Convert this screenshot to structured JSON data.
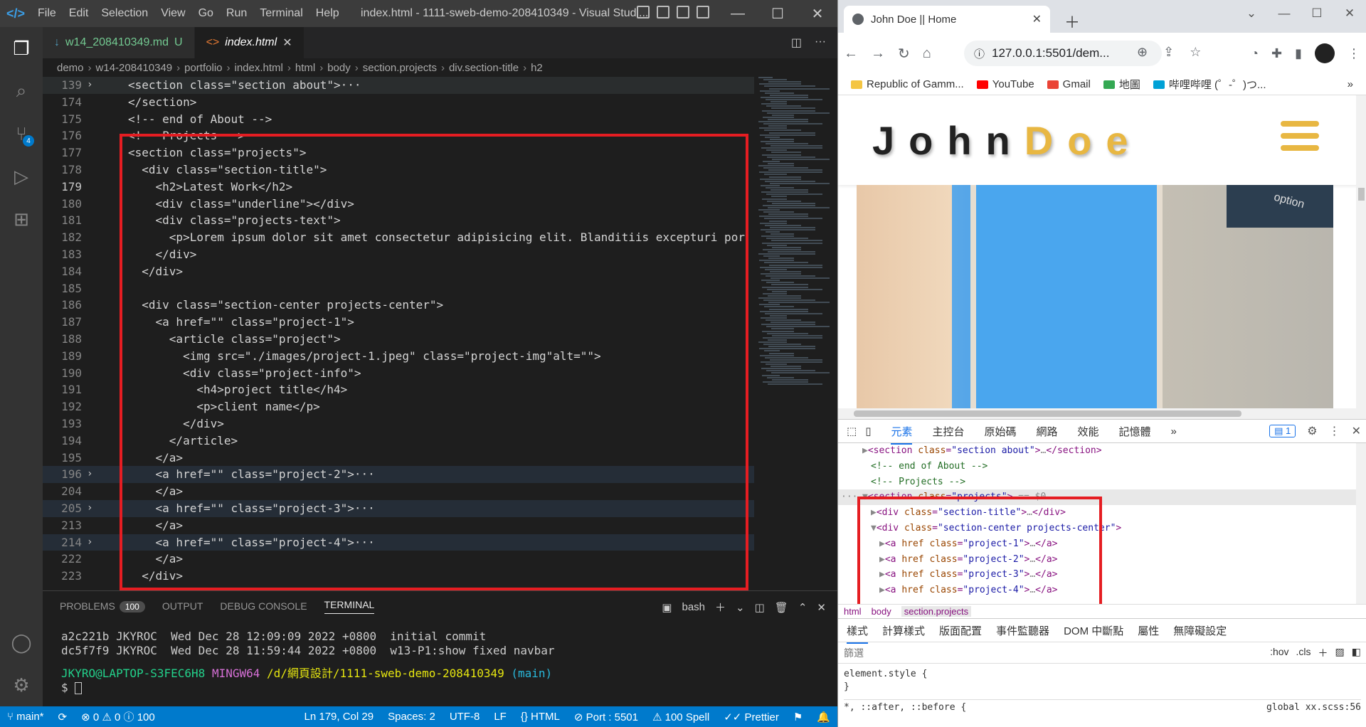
{
  "vscode": {
    "menu": [
      "File",
      "Edit",
      "Selection",
      "View",
      "Go",
      "Run",
      "Terminal",
      "Help"
    ],
    "window_title": "index.html - 1111-sweb-demo-208410349 - Visual Studi...",
    "tabs": [
      {
        "label": "w14_208410349.md",
        "status": "U"
      },
      {
        "label": "index.html"
      }
    ],
    "breadcrumbs": [
      "demo",
      "w14-208410349",
      "portfolio",
      "index.html",
      "html",
      "body",
      "section.projects",
      "div.section-title",
      "h2"
    ],
    "code_lines": [
      {
        "n": "139",
        "text": "<section class=\"section about\">···",
        "fold": "›",
        "cls": "hl"
      },
      {
        "n": "174",
        "text": "</section>"
      },
      {
        "n": "175",
        "text": "<!-- end of About -->"
      },
      {
        "n": "176",
        "text": "<!-- Projects -->"
      },
      {
        "n": "177",
        "text": "<section class=\"projects\">"
      },
      {
        "n": "178",
        "text": "  <div class=\"section-title\">"
      },
      {
        "n": "179",
        "text": "    <h2>Latest Work</h2>",
        "cur": true
      },
      {
        "n": "180",
        "text": "    <div class=\"underline\"></div>"
      },
      {
        "n": "181",
        "text": "    <div class=\"projects-text\">"
      },
      {
        "n": "182",
        "text": "      <p>Lorem ipsum dolor sit amet consectetur adipisicing elit. Blanditiis excepturi por"
      },
      {
        "n": "183",
        "text": "    </div>"
      },
      {
        "n": "184",
        "text": "  </div>"
      },
      {
        "n": "185",
        "text": ""
      },
      {
        "n": "186",
        "text": "  <div class=\"section-center projects-center\">"
      },
      {
        "n": "187",
        "text": "    <a href=\"\" class=\"project-1\">"
      },
      {
        "n": "188",
        "text": "      <article class=\"project\">"
      },
      {
        "n": "189",
        "text": "        <img src=\"./images/project-1.jpeg\" class=\"project-img\"alt=\"\">"
      },
      {
        "n": "190",
        "text": "        <div class=\"project-info\">"
      },
      {
        "n": "191",
        "text": "          <h4>project title</h4>"
      },
      {
        "n": "192",
        "text": "          <p>client name</p>"
      },
      {
        "n": "193",
        "text": "        </div>"
      },
      {
        "n": "194",
        "text": "      </article>"
      },
      {
        "n": "195",
        "text": "    </a>"
      },
      {
        "n": "196",
        "text": "    <a href=\"\" class=\"project-2\">···",
        "fold": "›",
        "cls": "folded"
      },
      {
        "n": "204",
        "text": "    </a>"
      },
      {
        "n": "205",
        "text": "    <a href=\"\" class=\"project-3\">···",
        "fold": "›",
        "cls": "folded"
      },
      {
        "n": "213",
        "text": "    </a>"
      },
      {
        "n": "214",
        "text": "    <a href=\"\" class=\"project-4\">···",
        "fold": "›",
        "cls": "folded"
      },
      {
        "n": "222",
        "text": "    </a>"
      },
      {
        "n": "223",
        "text": "  </div>"
      }
    ],
    "panel": {
      "tabs": [
        "PROBLEMS",
        "OUTPUT",
        "DEBUG CONSOLE",
        "TERMINAL"
      ],
      "problems_count": "100",
      "shell": "bash",
      "terminal": [
        "a2c221b JKYROC  Wed Dec 28 12:09:09 2022 +0800  initial commit",
        "dc5f7f9 JKYROC  Wed Dec 28 11:59:44 2022 +0800  w13-P1:show fixed navbar"
      ],
      "prompt_user": "JKYRO@LAPTOP-S3FEC6H8",
      "prompt_env": "MINGW64",
      "prompt_path": "/d/網頁設計/1111-sweb-demo-208410349",
      "prompt_branch": "(main)",
      "prompt_symbol": "$"
    },
    "status": {
      "branch": "main*",
      "errors": "0",
      "warnings": "0",
      "info": "100",
      "position": "Ln 179, Col 29",
      "spaces": "Spaces: 2",
      "encoding": "UTF-8",
      "eol": "LF",
      "language": "HTML",
      "port": "Port : 5501",
      "spell": "100 Spell",
      "prettier": "Prettier"
    }
  },
  "chrome": {
    "tab_title": "John Doe || Home",
    "url": "127.0.0.1:5501/dem...",
    "bookmarks": [
      "Republic of Gamm...",
      "YouTube",
      "Gmail",
      "地圖",
      "哔哩哔哩 (゜-゜)つ..."
    ],
    "site": {
      "logo_first": "John",
      "logo_accent": "Doe",
      "hero_key_text": "option"
    },
    "devtools": {
      "tabs": [
        "元素",
        "主控台",
        "原始碼",
        "網路",
        "效能",
        "記憶體"
      ],
      "issues": "1",
      "crumbs": [
        "html",
        "body",
        "section.projects"
      ],
      "styles_tabs": [
        "樣式",
        "計算樣式",
        "版面配置",
        "事件監聽器",
        "DOM 中斷點",
        "屬性",
        "無障礙設定"
      ],
      "filter_placeholder": "篩選",
      "hov": ":hov",
      "cls": ".cls",
      "element_style": "element.style {",
      "element_style_close": "}",
      "pseudo_rule": "*, ::after, ::before {",
      "pseudo_source": "global xx.scss:56"
    }
  }
}
